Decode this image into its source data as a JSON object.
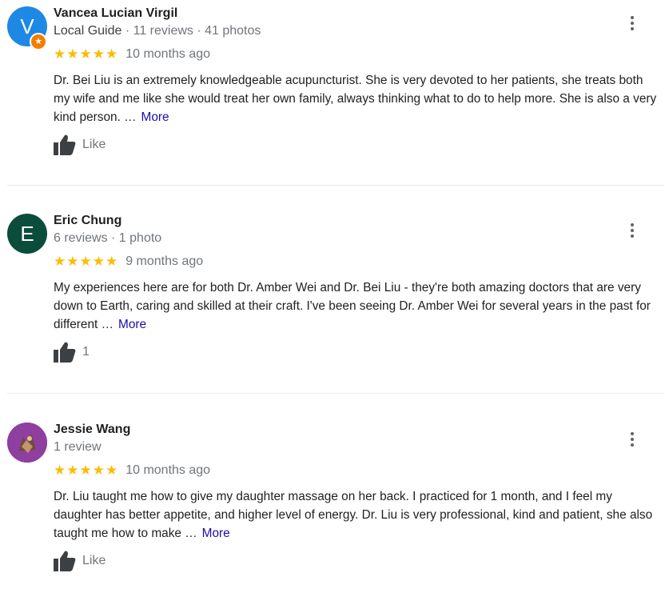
{
  "colors": {
    "star": "#fbbc04",
    "link": "#1a0dab",
    "secondary_text": "#70757a",
    "local_guide_badge": "#f57c00"
  },
  "reviews": [
    {
      "avatar_letter": "V",
      "avatar_color": "#1e88e5",
      "avatar_badge_icon": "star-badge-icon",
      "name": "Vancea Lucian Virgil",
      "local_guide": "Local Guide",
      "meta": " · 11 reviews · 41 photos",
      "stars": "★★★★★",
      "rating": 5,
      "date": "10 months ago",
      "text": "Dr. Bei Liu is an extremely knowledgeable acupuncturist. She is very devoted to her patients, she treats both my wife and me like she would treat her own family, always thinking what to do to help more. She is also a very kind person. …",
      "more": "More",
      "like": "Like"
    },
    {
      "avatar_letter": "E",
      "avatar_color": "#0b4d3b",
      "name": "Eric Chung",
      "meta": "6 reviews · 1 photo",
      "stars": "★★★★★",
      "rating": 5,
      "date": "9 months ago",
      "text": "My experiences here are for both Dr. Amber Wei and Dr. Bei Liu - they're both amazing doctors that are very down to Earth, caring and skilled at their craft. I've been seeing Dr. Amber Wei for several years in the past for different …",
      "more": "More",
      "like": "1"
    },
    {
      "avatar_color": "#8e3fa0",
      "avatar_icon": "profile-photo-icon",
      "name": "Jessie Wang",
      "meta": "1 review",
      "stars": "★★★★★",
      "rating": 5,
      "date": "10 months ago",
      "text": "Dr. Liu taught me how to give my daughter massage on her back. I practiced for 1 month, and I feel my daughter has better appetite, and higher level of energy. Dr. Liu is very professional, kind and patient, she also taught me how to make …",
      "more": "More",
      "like": "Like"
    }
  ]
}
